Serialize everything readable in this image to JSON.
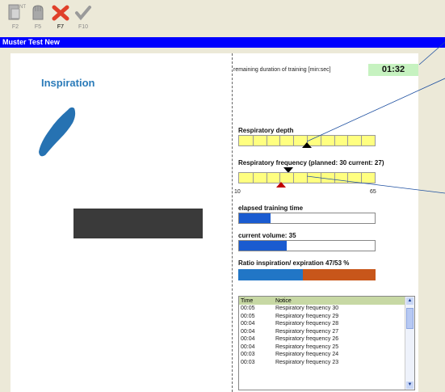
{
  "toolbar": {
    "buttons": [
      {
        "key": "F2",
        "icon": "document-icon",
        "active": false
      },
      {
        "key": "F5",
        "icon": "glove-icon",
        "active": false
      },
      {
        "key": "F7",
        "icon": "close-x-icon",
        "active": true
      },
      {
        "key": "F10",
        "icon": "checkmark-icon",
        "active": false
      }
    ]
  },
  "window": {
    "title": "Muster Test  New"
  },
  "left": {
    "phase_label": "Inspiration"
  },
  "training": {
    "remaining_label": "remaining duration of training [min:sec]",
    "remaining_value": "01:32",
    "depth_label": "Respiratory depth",
    "depth_level": 0.5,
    "freq_label": "Respiratory frequency (planned: 30 current: 27)",
    "freq_min": "10",
    "freq_max": "65",
    "freq_planned": 30,
    "freq_current": 27,
    "elapsed_label": "elapsed training time",
    "elapsed_fraction": 0.23,
    "volume_label": "current volume: 35",
    "volume_fraction": 0.35,
    "ratio_label": "Ratio inspiration/ expiration 47/53 %",
    "ratio_inspiration": 47,
    "ratio_expiration": 53
  },
  "log": {
    "headers": {
      "time": "Time",
      "notice": "Notice"
    },
    "rows": [
      {
        "time": "00:05",
        "notice": "Respiratory frequency 30"
      },
      {
        "time": "00:05",
        "notice": "Respiratory frequency 29"
      },
      {
        "time": "00:04",
        "notice": "Respiratory frequency 28"
      },
      {
        "time": "00:04",
        "notice": "Respiratory frequency 27"
      },
      {
        "time": "00:04",
        "notice": "Respiratory frequency 26"
      },
      {
        "time": "00:04",
        "notice": "Respiratory frequency 25"
      },
      {
        "time": "00:03",
        "notice": "Respiratory frequency 24"
      },
      {
        "time": "00:03",
        "notice": "Respiratory frequency 23"
      }
    ]
  },
  "colors": {
    "titlebar": "#0000ff",
    "inspiration": "#2b7bb9",
    "progress": "#1a5bd0",
    "ratio_exp": "#c8561a",
    "timer_bg": "#c6f2c0",
    "bar_yellow": "#ffff80"
  }
}
